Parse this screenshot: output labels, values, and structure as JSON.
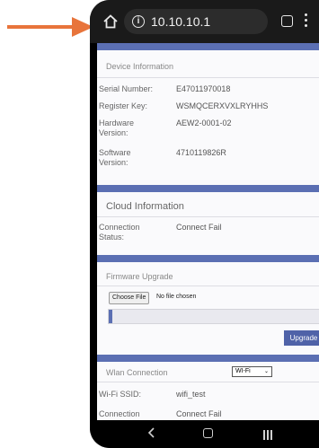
{
  "browser": {
    "url": "10.10.10.1",
    "tabs_count": ""
  },
  "device_info": {
    "title": "Device Information",
    "rows": [
      {
        "label": "Serial Number:",
        "value": "E47011970018"
      },
      {
        "label": "Register Key:",
        "value": "WSMQCERXVXLRYHHS"
      },
      {
        "label": "Hardware\nVersion:",
        "value": "AEW2-0001-02"
      },
      {
        "label": "Software\nVersion:",
        "value": "4710119826R"
      }
    ]
  },
  "cloud_info": {
    "title": "Cloud Information",
    "rows": [
      {
        "label": "Connection\nStatus:",
        "value": "Connect Fail"
      }
    ]
  },
  "firmware": {
    "title": "Firmware Upgrade",
    "choose_file_label": "Choose File",
    "no_file_text": "No file chosen",
    "upgrade_label": "Upgrade",
    "progress_percent": 0
  },
  "wlan": {
    "title": "Wlan Connection",
    "mode_selected": "WI-Fi",
    "ssid_label": "Wi-Fi SSID:",
    "ssid_value": "wifi_test",
    "conn_label": "Connection",
    "conn_value": "Connect Fail"
  },
  "colors": {
    "accent": "#5b6fb3",
    "button": "#4f62a8",
    "arrow": "#e8743b"
  }
}
